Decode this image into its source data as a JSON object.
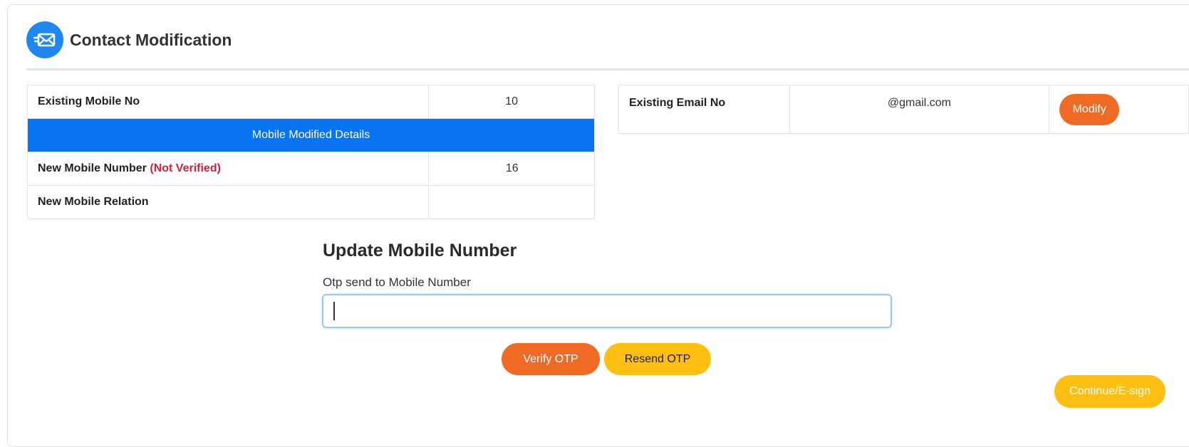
{
  "header": {
    "title": "Contact Modification",
    "icon": "envelope-icon",
    "icon_bg": "#1e88f0"
  },
  "mobile_table": {
    "existing_label": "Existing Mobile No",
    "existing_value": "10",
    "section_header": "Mobile Modified Details",
    "new_number_label": "New Mobile Number",
    "new_number_status": "(Not Verified)",
    "new_number_value": " 16",
    "relation_label": "New Mobile Relation",
    "relation_value": ""
  },
  "email_table": {
    "existing_label": "Existing Email No",
    "existing_value": "@gmail.com",
    "modify_button": "Modify"
  },
  "update_section": {
    "title": "Update Mobile Number",
    "otp_label": "Otp send to Mobile Number",
    "otp_value": "",
    "verify_button": "Verify OTP",
    "resend_button": "Resend OTP"
  },
  "footer": {
    "continue_button": "Continue/E-sign"
  },
  "colors": {
    "primary_blue": "#0a73f2",
    "orange": "#ef6b25",
    "yellow": "#fcbf12",
    "error_red": "#d0213c"
  }
}
